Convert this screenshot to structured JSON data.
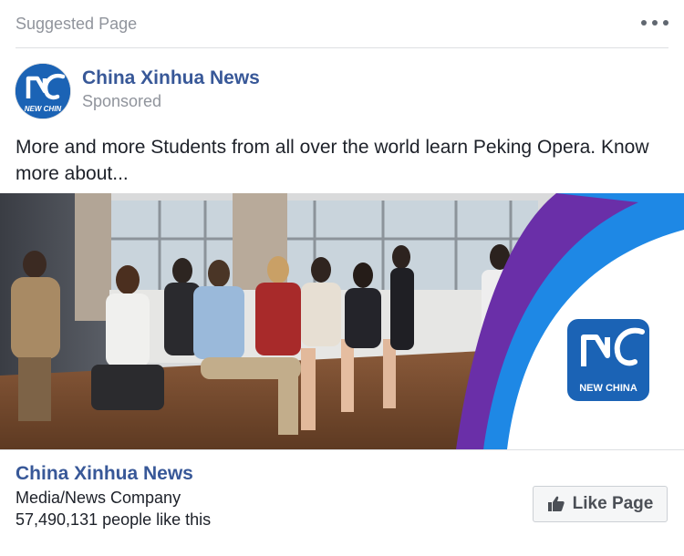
{
  "header": {
    "title": "Suggested Page",
    "more_icon": "more-horizontal-icon"
  },
  "page": {
    "name": "China Xinhua News",
    "sponsored": "Sponsored",
    "logo_text": "NEW CHINA",
    "logo_text_small": "NEW CHIN"
  },
  "post": {
    "text": "More and more Students from all over the world learn Peking Opera. Know more about..."
  },
  "footer": {
    "name": "China Xinhua News",
    "category": "Media/News Company",
    "likes": "57,490,131 people like this",
    "like_button_label": "Like Page",
    "like_icon": "thumbs-up-icon"
  },
  "colors": {
    "link_blue": "#385898",
    "logo_blue": "#1b63b5",
    "arc_purple": "#6a2fa8",
    "arc_blue": "#1e88e5",
    "muted_text": "#90949c"
  }
}
